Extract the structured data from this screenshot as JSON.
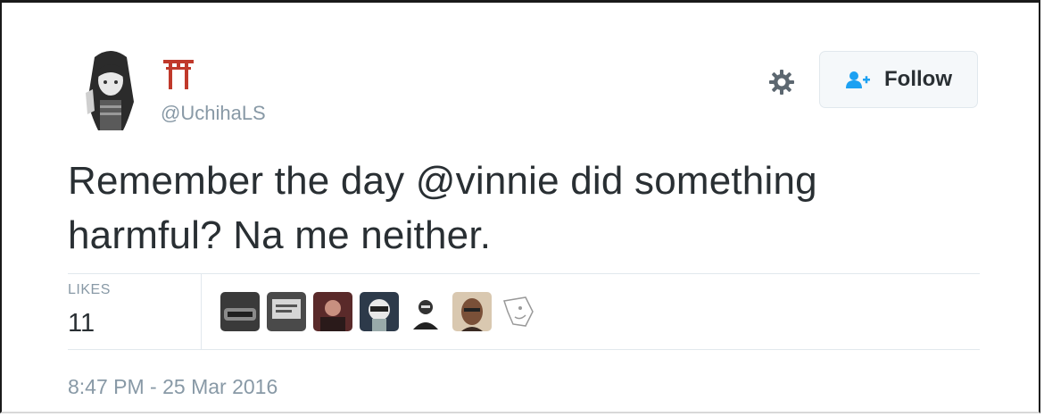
{
  "tweet": {
    "handle": "@UchihaLS",
    "text_before": "Remember the day ",
    "mention": "@vinnie",
    "text_after": " did something harmful? Na me neither.",
    "timestamp": "8:47 PM - 25 Mar 2016"
  },
  "actions": {
    "follow_label": "Follow",
    "settings_icon": "gear-icon",
    "follow_icon": "add-user-icon"
  },
  "stats": {
    "likes_label": "LIKES",
    "likes_count": "11"
  },
  "likers": [
    {
      "icon": "liker-avatar-1"
    },
    {
      "icon": "liker-avatar-2"
    },
    {
      "icon": "liker-avatar-3"
    },
    {
      "icon": "liker-avatar-4"
    },
    {
      "icon": "liker-avatar-5"
    },
    {
      "icon": "liker-avatar-6"
    },
    {
      "icon": "liker-avatar-7"
    }
  ],
  "colors": {
    "text": "#292f33",
    "muted": "#8899a6",
    "follow_icon": "#1da1f2",
    "torii": "#c0392b"
  }
}
